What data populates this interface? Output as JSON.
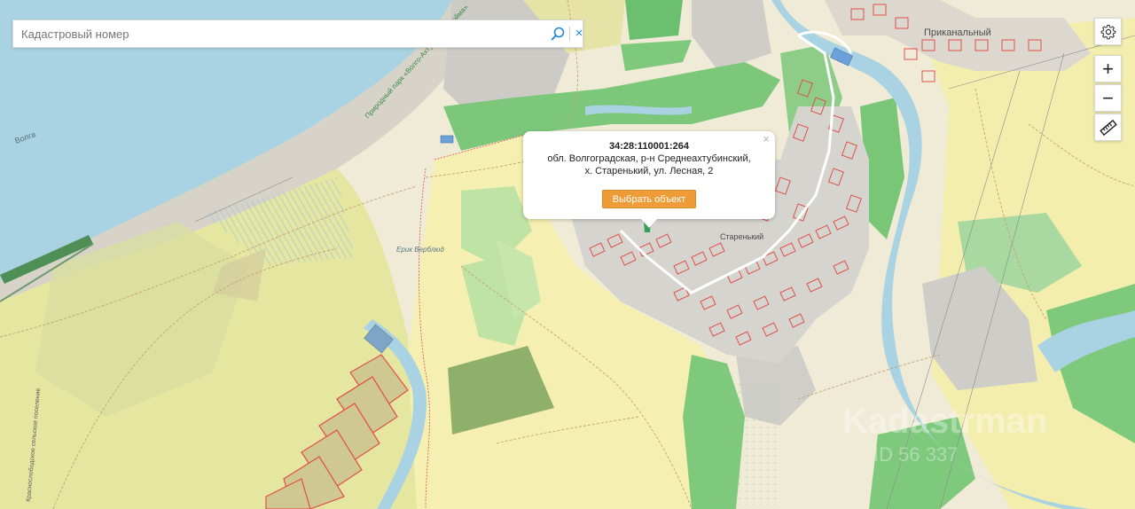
{
  "search": {
    "placeholder": "Кадастровый номер",
    "clear_symbol": "×",
    "icon": "search-icon"
  },
  "controls": {
    "settings_icon": "gear-icon",
    "zoom_in": "+",
    "zoom_out": "−",
    "ruler_icon": "ruler-icon"
  },
  "popup": {
    "close_symbol": "×",
    "cadastral_number": "34:28:110001:264",
    "address": "обл. Волгоградская, р-н Среднеахтубинский, х. Старенький, ул. Лесная, 2",
    "select_button": "Выбрать объект"
  },
  "map_labels": {
    "settlement_1": "Приканальный",
    "settlement_2": "Старенький",
    "river_left": "Волга",
    "park_name": "Природный парк «Волго-Ахтубинская пойма»",
    "lake_name": "Ерик Верблюд",
    "road_left": "Краснослободское сельское поселение"
  },
  "watermark": {
    "text": "Kadastrman",
    "id_text": "ID 56 337"
  },
  "colors": {
    "water": "#a9d3e2",
    "forest": "#61b965",
    "field_yellow": "#f3eea0",
    "field_light": "#f5f0cd",
    "settlement_gray": "#cfcfcf",
    "parcel_outline": "#e0504a",
    "accent_button": "#ee9c38"
  }
}
